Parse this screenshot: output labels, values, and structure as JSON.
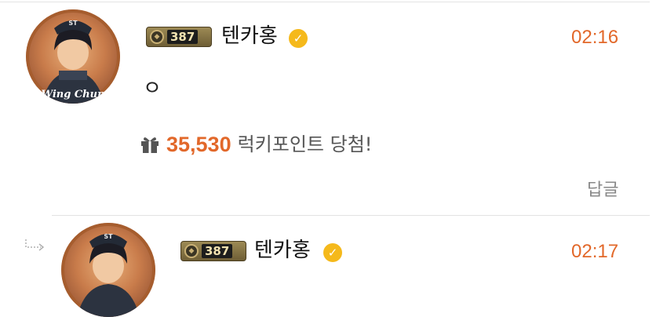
{
  "comments": [
    {
      "level": "387",
      "nickname": "텐카홍",
      "time": "02:16",
      "text": "ㅇ",
      "lucky_points": "35,530",
      "lucky_label": "럭키포인트 당첨!",
      "reply_label": "답글",
      "avatar_text": "Wing Chun",
      "avatar_badge": "ST"
    },
    {
      "level": "387",
      "nickname": "텐카홍",
      "time": "02:17",
      "avatar_badge": "ST"
    }
  ],
  "colors": {
    "accent": "#e2682a",
    "verified": "#f5b91b",
    "divider": "#e3e3e3"
  },
  "icons": {
    "verified": "check-badge-icon",
    "gift": "gift-icon",
    "reply_indicator": "reply-arrow-icon"
  }
}
